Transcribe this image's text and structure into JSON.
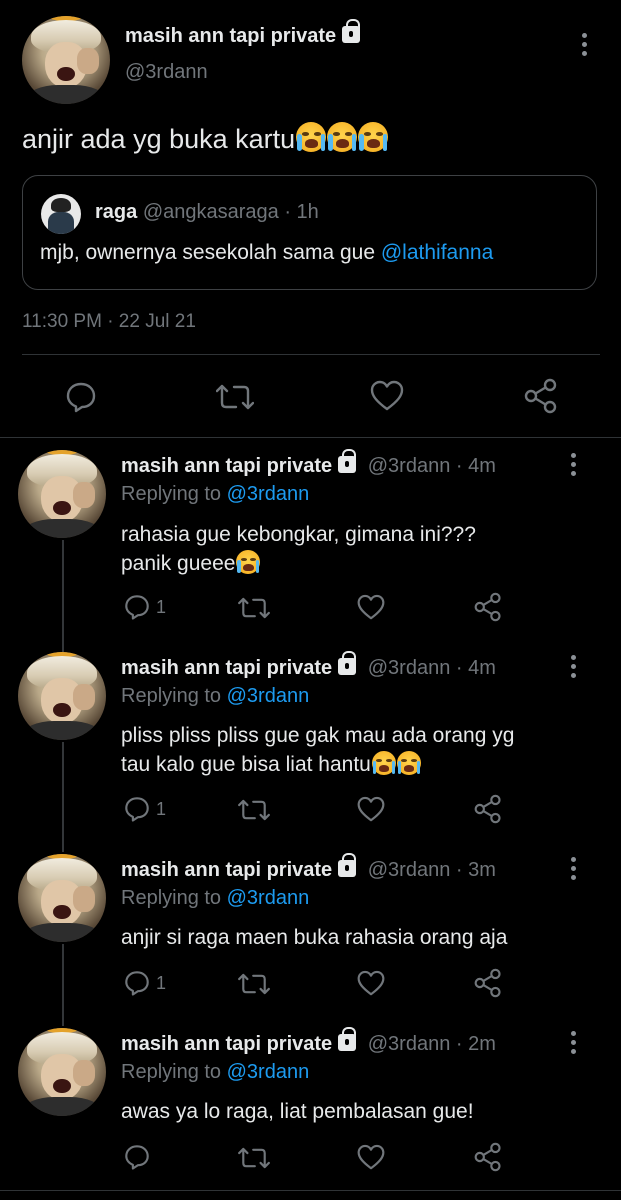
{
  "main_tweet": {
    "name": "masih ann tapi private",
    "handle": "@3rdann",
    "text": "anjir ada yg buka kartu",
    "emoji": "😭😭😭",
    "timestamp": "11:30 PM · 22 Jul 21",
    "quoted": {
      "name": "raga",
      "handle": "@angkasaraga",
      "time": "· 1h",
      "text": "mjb, ownernya sesekolah sama gue",
      "mention": "@lathifanna"
    }
  },
  "replies": [
    {
      "name": "masih ann tapi private",
      "handle": "@3rdann",
      "time": "· 4m",
      "replying_label": "Replying to",
      "replying_to": "@3rdann",
      "line1": "rahasia gue kebongkar, gimana ini???",
      "line2": "panik gueee",
      "reply_count": "1"
    },
    {
      "name": "masih ann tapi private",
      "handle": "@3rdann",
      "time": "· 4m",
      "replying_label": "Replying to",
      "replying_to": "@3rdann",
      "line1": "pliss pliss pliss gue gak mau ada orang yg",
      "line2": "tau kalo gue bisa liat hantu",
      "reply_count": "1"
    },
    {
      "name": "masih ann tapi private",
      "handle": "@3rdann",
      "time": "· 3m",
      "replying_label": "Replying to",
      "replying_to": "@3rdann",
      "line1": "anjir si raga maen buka rahasia orang aja",
      "reply_count": "1"
    },
    {
      "name": "masih ann tapi private",
      "handle": "@3rdann",
      "time": "· 2m",
      "replying_label": "Replying to",
      "replying_to": "@3rdann",
      "line1": "awas ya lo raga, liat pembalasan gue!",
      "reply_count": ""
    }
  ],
  "icons": {
    "reply": "reply-icon",
    "retweet": "retweet-icon",
    "like": "like-icon",
    "share": "share-icon",
    "more": "more-options-icon",
    "lock": "lock-icon",
    "emoji": "loudly-crying-face-emoji"
  },
  "colors": {
    "background": "#000000",
    "text": "#e7e9ea",
    "muted": "#71767b",
    "link": "#1d9bf0",
    "border": "#2f3336"
  }
}
